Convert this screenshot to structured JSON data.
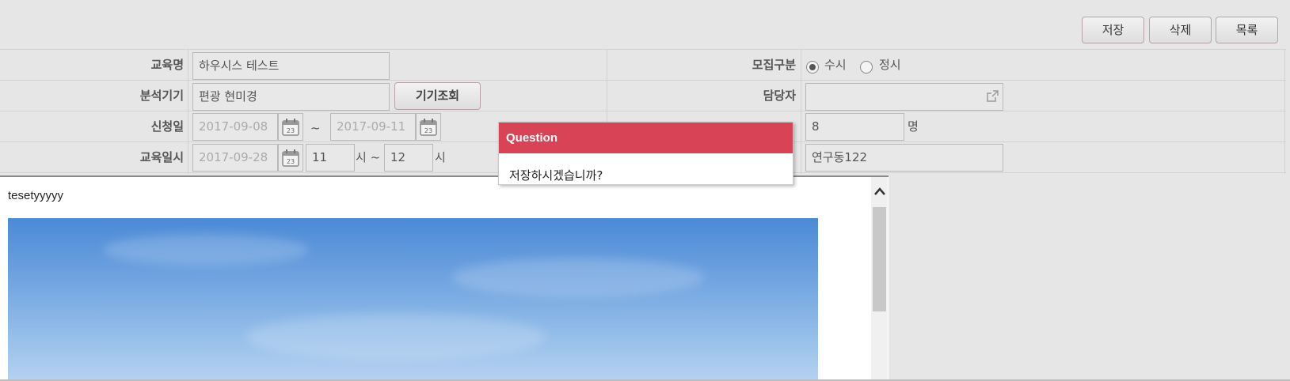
{
  "toolbar": {
    "save_label": "저장",
    "delete_label": "삭제",
    "list_label": "목록"
  },
  "form": {
    "course_name_label": "교육명",
    "course_name_value": "하우시스 테스트",
    "recruit_type_label": "모집구분",
    "recruit_options": [
      "수시",
      "정시"
    ],
    "recruit_selected": "수시",
    "device_label": "분석기기",
    "device_value": "편광 현미경",
    "device_lookup_label": "기기조회",
    "manager_label": "담당자",
    "manager_value": "",
    "apply_date_label": "신청일",
    "apply_start": "2017-09-08",
    "apply_tilde": "~",
    "apply_end": "2017-09-11",
    "count_value": "8",
    "count_unit": "명",
    "edu_datetime_label": "교육일시",
    "edu_date": "2017-09-28",
    "edu_start_hour": "11",
    "hour_unit": "시",
    "hour_tilde": "시 ~",
    "edu_end_hour": "12",
    "location_value": "연구동122",
    "calendar_day": "23"
  },
  "dialog": {
    "title": "Question",
    "message": "저장하시겠습니까?"
  },
  "editor": {
    "text": "tesetyyyyy"
  },
  "colors": {
    "dialog_header": "#d84456",
    "background": "#e6e6e6"
  },
  "icons": [
    "calendar-icon",
    "external-link-icon",
    "chevron-up-icon"
  ]
}
